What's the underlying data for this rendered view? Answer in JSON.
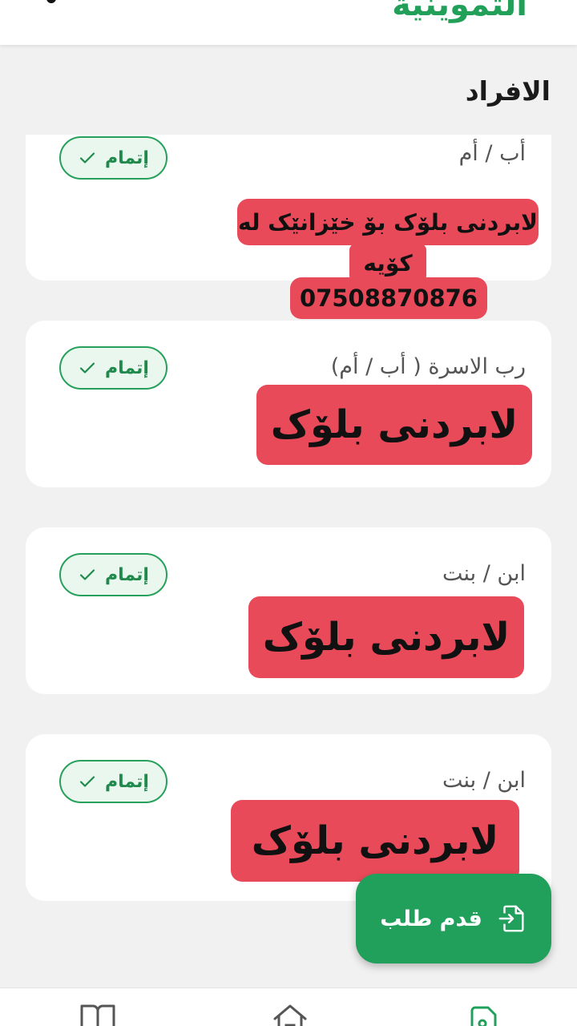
{
  "header": {
    "title": "التموينية"
  },
  "section": {
    "title": "الافراد"
  },
  "members": [
    {
      "role": "أب / أم",
      "status": "إتمام"
    },
    {
      "role": "رب الاسرة ( أب / أم)",
      "status": "إتمام"
    },
    {
      "role": "ابن / بنت",
      "status": "إتمام"
    },
    {
      "role": "ابن / بنت",
      "status": "إتمام"
    }
  ],
  "overlays": {
    "ad_line1": "لابردنی بلۆک بۆ خێزانێک له",
    "ad_line2": "کۆیه",
    "ad_phone": "07508870876",
    "label1": "لابردنی بلۆک",
    "label2": "لابردنی بلۆک",
    "label3": "لابردنی بلۆک"
  },
  "fab": {
    "label": "قدم طلب"
  },
  "bottom_nav": {
    "items": [
      {
        "icon": "book-icon"
      },
      {
        "icon": "home-icon"
      },
      {
        "icon": "document-icon",
        "active": true
      }
    ]
  },
  "colors": {
    "accent": "#21a05c",
    "overlay": "#e84a59",
    "background": "#f1f1f1"
  }
}
